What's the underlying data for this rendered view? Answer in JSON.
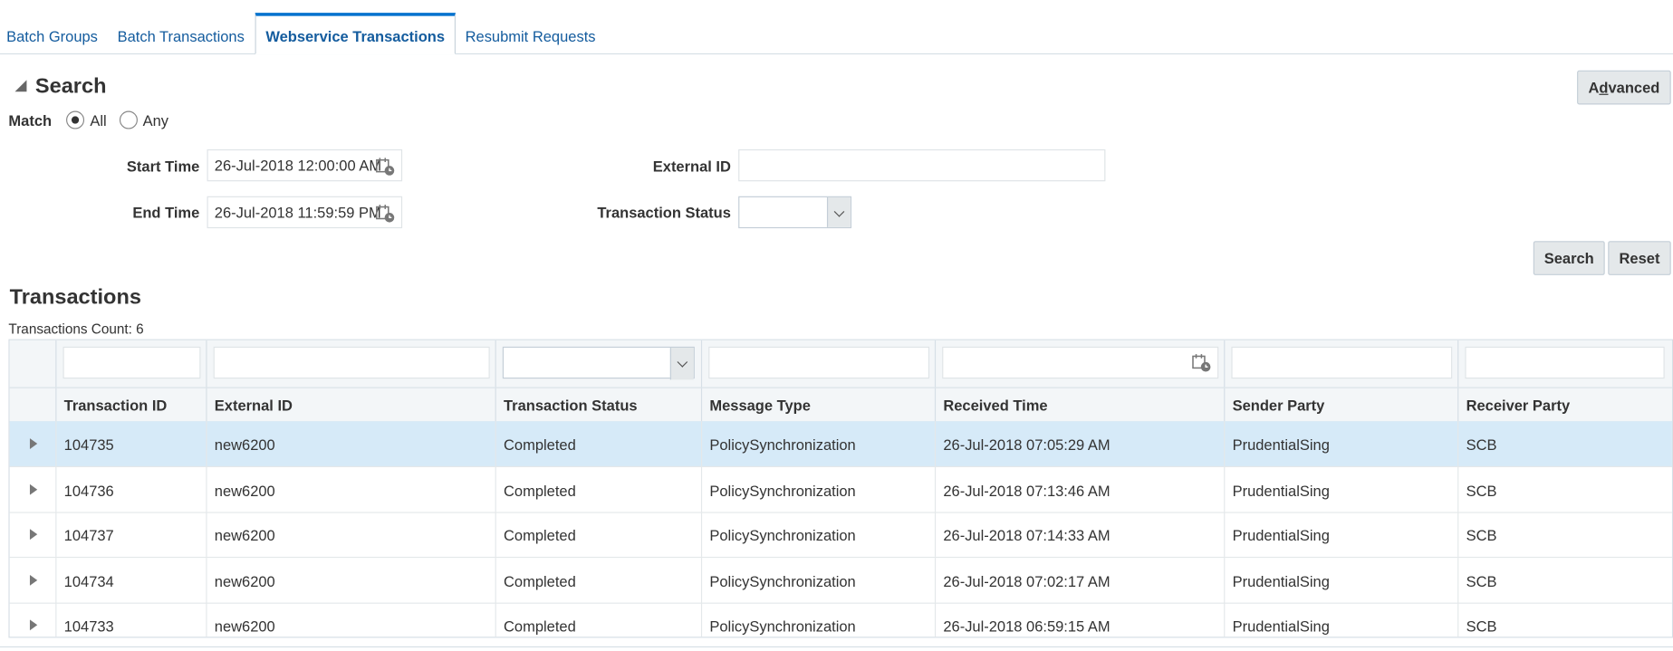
{
  "tabs": [
    {
      "label": "Batch Groups"
    },
    {
      "label": "Batch Transactions"
    },
    {
      "label": "Webservice Transactions",
      "active": true
    },
    {
      "label": "Resubmit Requests"
    }
  ],
  "search": {
    "title": "Search",
    "advanced_label_pre": "A",
    "advanced_label_u": "d",
    "advanced_label_post": "vanced",
    "match_label": "Match",
    "match_all": "All",
    "match_any": "Any",
    "start_time_label": "Start Time",
    "start_time_value": "26-Jul-2018 12:00:00 AM",
    "end_time_label": "End Time",
    "end_time_value": "26-Jul-2018 11:59:59 PM",
    "external_id_label": "External ID",
    "external_id_value": "",
    "status_label": "Transaction Status",
    "status_value": "",
    "search_button": "Search",
    "reset_button": "Reset"
  },
  "transactions": {
    "title": "Transactions",
    "count_text": "Transactions Count: 6",
    "columns": [
      "Transaction ID",
      "External ID",
      "Transaction Status",
      "Message Type",
      "Received Time",
      "Sender Party",
      "Receiver Party"
    ],
    "rows": [
      {
        "id": "104735",
        "ext": "new6200",
        "status": "Completed",
        "type": "PolicySynchronization",
        "received": "26-Jul-2018 07:05:29 AM",
        "sender": "PrudentialSing",
        "receiver": "SCB"
      },
      {
        "id": "104736",
        "ext": "new6200",
        "status": "Completed",
        "type": "PolicySynchronization",
        "received": "26-Jul-2018 07:13:46 AM",
        "sender": "PrudentialSing",
        "receiver": "SCB"
      },
      {
        "id": "104737",
        "ext": "new6200",
        "status": "Completed",
        "type": "PolicySynchronization",
        "received": "26-Jul-2018 07:14:33 AM",
        "sender": "PrudentialSing",
        "receiver": "SCB"
      },
      {
        "id": "104734",
        "ext": "new6200",
        "status": "Completed",
        "type": "PolicySynchronization",
        "received": "26-Jul-2018 07:02:17 AM",
        "sender": "PrudentialSing",
        "receiver": "SCB"
      },
      {
        "id": "104733",
        "ext": "new6200",
        "status": "Completed",
        "type": "PolicySynchronization",
        "received": "26-Jul-2018 06:59:15 AM",
        "sender": "PrudentialSing",
        "receiver": "SCB"
      }
    ]
  },
  "icons": {
    "calendar": "calendar-icon",
    "dropdown": "chevron-down-icon",
    "expand": "expand-row-icon"
  },
  "colors": {
    "link": "#145c9e",
    "active_tab_border": "#0572ce",
    "selected_row": "#d6eaf8"
  }
}
